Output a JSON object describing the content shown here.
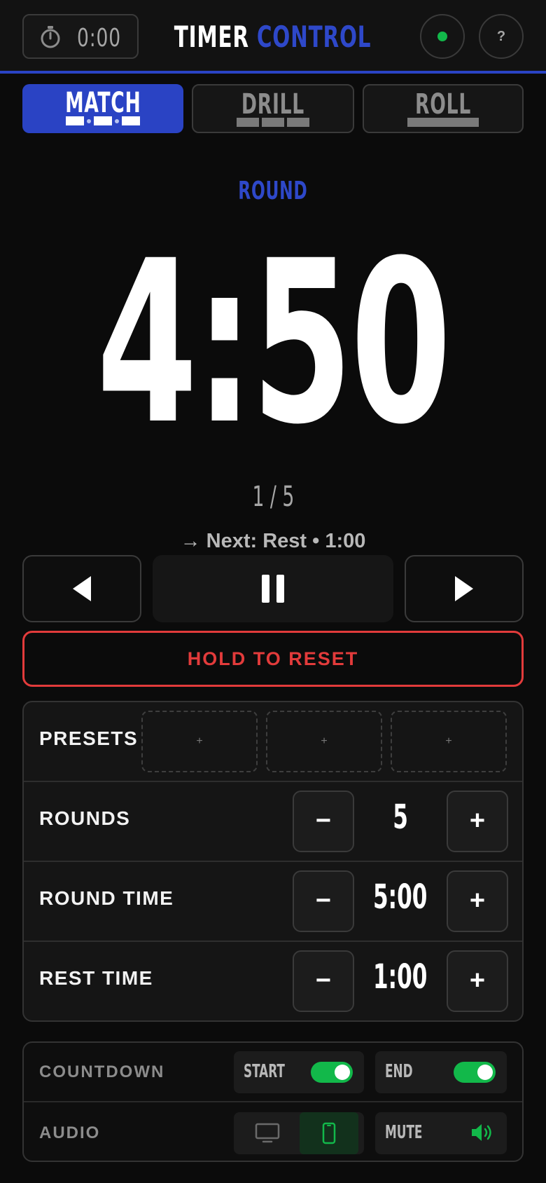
{
  "header": {
    "mini_timer": "0:00",
    "title_part1": "TIMER",
    "title_part2": "CONTROL",
    "help_label": "?"
  },
  "modes": [
    {
      "label": "MATCH",
      "active": true
    },
    {
      "label": "DRILL",
      "active": false
    },
    {
      "label": "ROLL",
      "active": false
    }
  ],
  "timer": {
    "phase": "ROUND",
    "time": "4:50",
    "round_counter": "1 / 5",
    "next": "→ Next: Rest • 1:00"
  },
  "controls": {
    "reset_label": "HOLD TO RESET"
  },
  "settings": {
    "presets": {
      "label": "PRESETS",
      "slots": [
        "+",
        "+",
        "+"
      ]
    },
    "rounds": {
      "label": "ROUNDS",
      "value": "5",
      "minus": "−",
      "plus": "+"
    },
    "round_time": {
      "label": "ROUND TIME",
      "value": "5:00",
      "minus": "−",
      "plus": "+"
    },
    "rest_time": {
      "label": "REST TIME",
      "value": "1:00",
      "minus": "−",
      "plus": "+"
    }
  },
  "options": {
    "countdown": {
      "label": "COUNTDOWN",
      "start_label": "START",
      "start_on": true,
      "end_label": "END",
      "end_on": true
    },
    "audio": {
      "label": "AUDIO",
      "selected_device": "phone-icon",
      "mute_label": "MUTE"
    }
  },
  "colors": {
    "accent": "#2a43c4",
    "danger": "#e23b3b",
    "success": "#12b84a"
  }
}
